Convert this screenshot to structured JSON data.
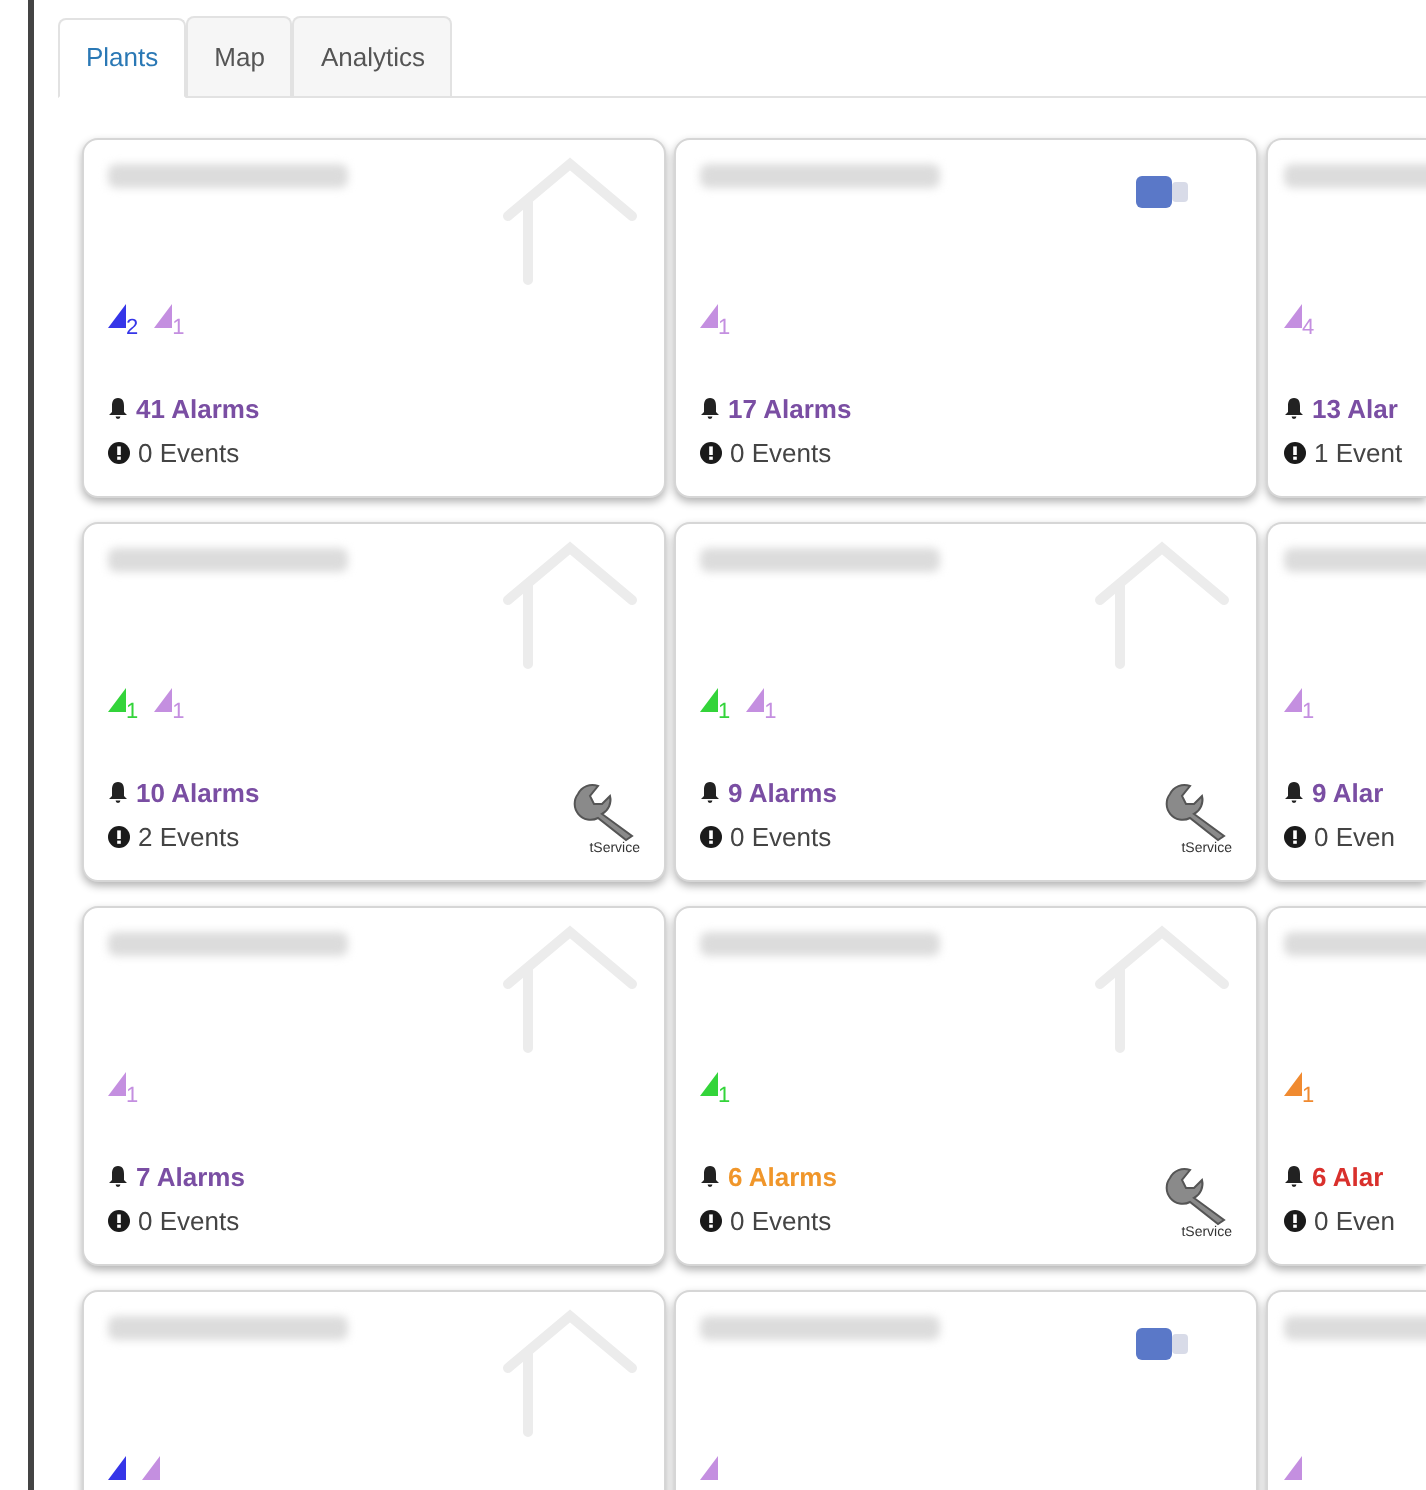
{
  "tabs": [
    {
      "label": "Plants",
      "selected": true
    },
    {
      "label": "Map",
      "selected": false
    },
    {
      "label": "Analytics",
      "selected": false
    }
  ],
  "plants": [
    {
      "kind": "house",
      "signals": [
        {
          "color": "#3535e8",
          "count": "2"
        },
        {
          "color": "#c48fe0",
          "count": "1"
        }
      ],
      "alarms": {
        "text": "41 Alarms",
        "color": "#7a4ea3"
      },
      "events": "0 Events"
    },
    {
      "kind": "device",
      "signals": [
        {
          "color": "#c48fe0",
          "count": "1"
        }
      ],
      "alarms": {
        "text": "17 Alarms",
        "color": "#7a4ea3"
      },
      "events": "0 Events"
    },
    {
      "kind": "plain",
      "signals": [
        {
          "color": "#c48fe0",
          "count": "4"
        }
      ],
      "alarms": {
        "text": "13 Alar",
        "color": "#7a4ea3"
      },
      "events": "1 Event"
    },
    {
      "kind": "house",
      "signals": [
        {
          "color": "#33d43a",
          "count": "1"
        },
        {
          "color": "#c48fe0",
          "count": "1"
        }
      ],
      "alarms": {
        "text": "10 Alarms",
        "color": "#7a4ea3"
      },
      "events": "2 Events",
      "service": "tService"
    },
    {
      "kind": "house",
      "signals": [
        {
          "color": "#33d43a",
          "count": "1"
        },
        {
          "color": "#c48fe0",
          "count": "1"
        }
      ],
      "alarms": {
        "text": "9 Alarms",
        "color": "#7a4ea3"
      },
      "events": "0 Events",
      "service": "tService"
    },
    {
      "kind": "plain",
      "signals": [
        {
          "color": "#c48fe0",
          "count": "1"
        }
      ],
      "alarms": {
        "text": "9 Alar",
        "color": "#7a4ea3"
      },
      "events": "0 Even"
    },
    {
      "kind": "house",
      "signals": [
        {
          "color": "#c48fe0",
          "count": "1"
        }
      ],
      "alarms": {
        "text": "7 Alarms",
        "color": "#7a4ea3"
      },
      "events": "0 Events"
    },
    {
      "kind": "house",
      "signals": [
        {
          "color": "#33d43a",
          "count": "1"
        }
      ],
      "alarms": {
        "text": "6 Alarms",
        "color": "#f0962a"
      },
      "events": "0 Events",
      "service": "tService"
    },
    {
      "kind": "plain",
      "signals": [
        {
          "color": "#f08a30",
          "count": "1"
        }
      ],
      "alarms": {
        "text": "6 Alar",
        "color": "#d9302c"
      },
      "events": "0 Even"
    },
    {
      "kind": "house",
      "signals": [
        {
          "color": "#3535e8"
        },
        {
          "color": "#c48fe0"
        }
      ]
    },
    {
      "kind": "device",
      "signals": [
        {
          "color": "#c48fe0"
        }
      ]
    },
    {
      "kind": "plain",
      "signals": [
        {
          "color": "#c48fe0"
        }
      ]
    }
  ]
}
